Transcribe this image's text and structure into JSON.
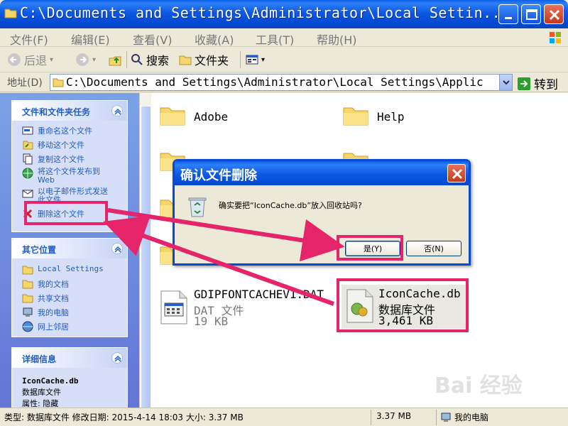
{
  "window": {
    "title": "C:\\Documents and Settings\\Administrator\\Local Settin...",
    "accent": "#0a5fe8"
  },
  "menu": {
    "items": [
      "文件(F)",
      "编辑(E)",
      "查看(V)",
      "收藏(A)",
      "工具(T)",
      "帮助(H)"
    ]
  },
  "toolbar": {
    "back": "后退",
    "search": "搜索",
    "folders": "文件夹"
  },
  "address": {
    "label": "地址(D)",
    "value": "C:\\Documents and Settings\\Administrator\\Local Settings\\Applic",
    "go": "转到"
  },
  "left_panel": {
    "tasks": {
      "title": "文件和文件夹任务",
      "items": [
        "重命名这个文件",
        "移动这个文件",
        "复制这个文件",
        "将这个文件发布到",
        "Web",
        "以电子邮件形式发送",
        "此文件",
        "删除这个文件"
      ]
    },
    "places": {
      "title": "其它位置",
      "items": [
        "Local Settings",
        "我的文档",
        "共享文档",
        "我的电脑",
        "网上邻居"
      ]
    },
    "details": {
      "title": "详细信息",
      "name": "IconCache.db",
      "type": "数据库文件",
      "attr": "属性: 隐藏"
    }
  },
  "files": {
    "folder1": "Adobe",
    "folder2": "Help",
    "gdi_name": "GDIPFONTCACHEV1.DAT",
    "gdi_type": "DAT 文件",
    "gdi_size": "19 KB",
    "icon_name": "IconCache.db",
    "icon_type": "数据库文件",
    "icon_size": "3,461 KB"
  },
  "dialog": {
    "title": "确认文件删除",
    "message": "确实要把“IconCache.db”放入回收站吗?",
    "yes": "是(Y)",
    "no": "否(N)"
  },
  "status": {
    "info": "类型: 数据库文件 修改日期: 2015-4-14 18:03 大小: 3.37 MB",
    "size": "3.37 MB",
    "location": "我的电脑"
  },
  "watermark": "Bai 经验",
  "highlight_color": "#e6246a"
}
